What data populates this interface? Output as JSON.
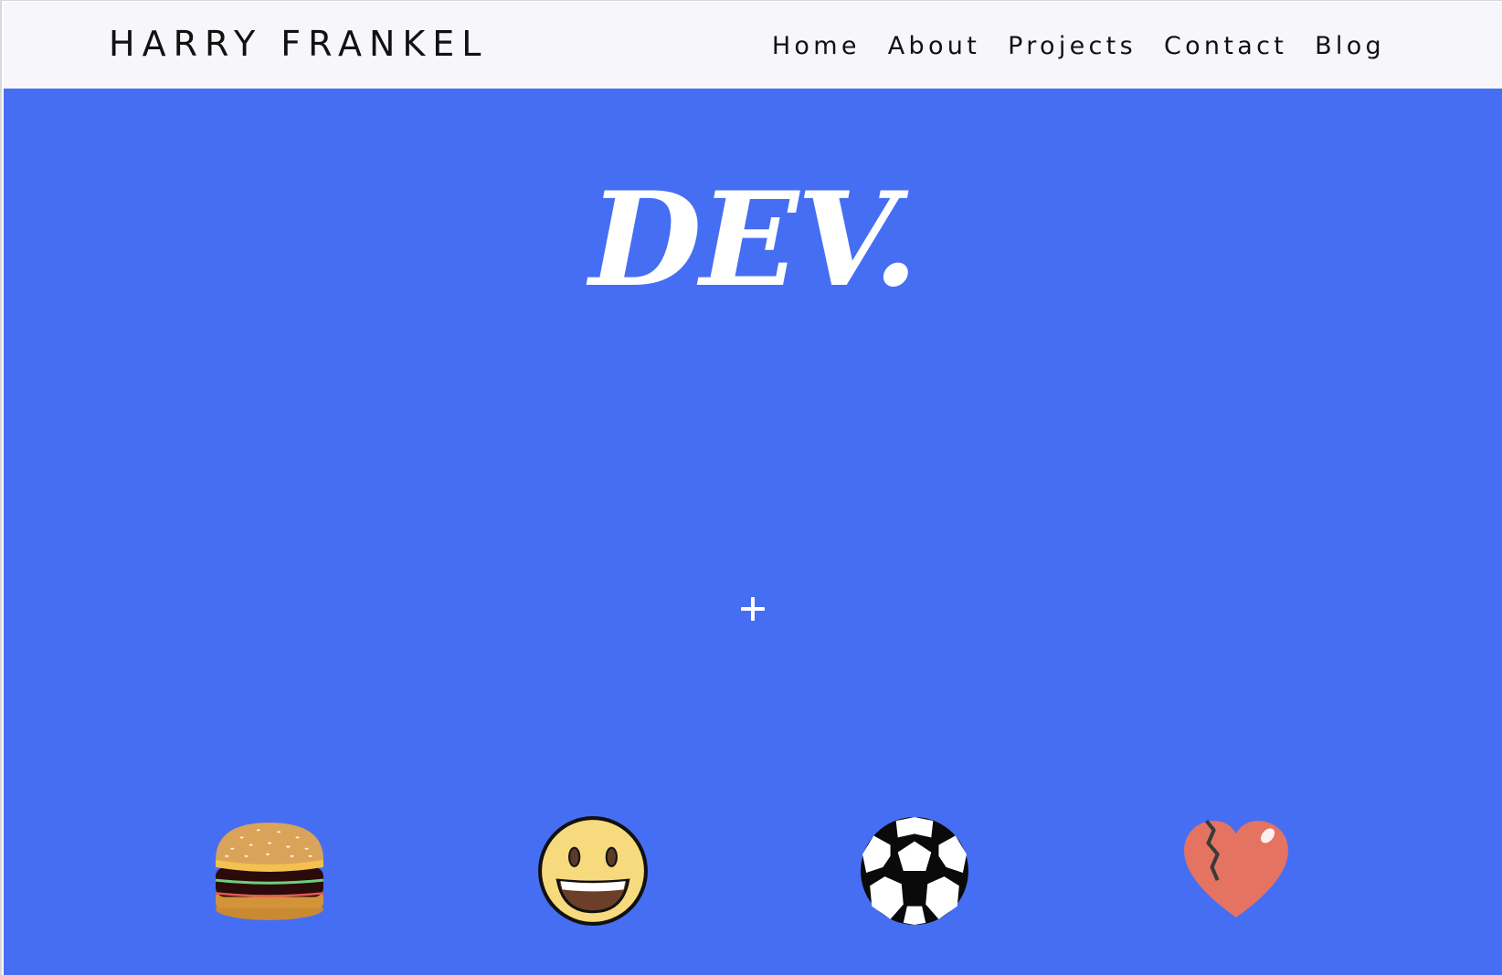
{
  "header": {
    "brand": "HARRY FRANKEL",
    "nav": [
      {
        "label": "Home"
      },
      {
        "label": "About"
      },
      {
        "label": "Projects"
      },
      {
        "label": "Contact"
      },
      {
        "label": "Blog"
      }
    ]
  },
  "hero": {
    "title": "DEV.",
    "background_color": "#466ef3",
    "icons": [
      {
        "name": "hamburger-icon"
      },
      {
        "name": "grinning-face-icon"
      },
      {
        "name": "soccer-ball-icon"
      },
      {
        "name": "broken-heart-icon"
      }
    ],
    "plus_icon": "plus-icon"
  }
}
